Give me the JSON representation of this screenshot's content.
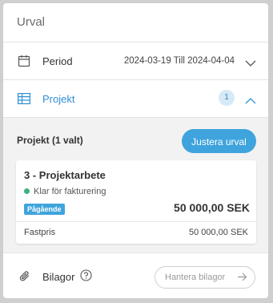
{
  "header": {
    "title": "Urval"
  },
  "period": {
    "label": "Period",
    "value": "2024-03-19 Till 2024-04-04",
    "icons": [
      "calendar-icon",
      "chevron-down-icon"
    ]
  },
  "project": {
    "label": "Projekt",
    "count": "1",
    "icons": [
      "table-icon",
      "chevron-up-icon"
    ]
  },
  "selection": {
    "title": "Projekt (1 valt)",
    "adjust_label": "Justera urval",
    "card": {
      "title": "3 - Projektarbete",
      "status": "Klar för fakturering",
      "tag": "Pågående",
      "amount": "50 000,00 SEK",
      "line_label": "Fastpris",
      "line_value": "50 000,00 SEK"
    }
  },
  "attachments": {
    "label": "Bilagor",
    "manage_label": "Hantera bilagor",
    "icons": [
      "paperclip-icon",
      "help-icon",
      "arrow-right-icon"
    ]
  },
  "colors": {
    "accent": "#3fa4dd",
    "status_green": "#3bb27e",
    "link_blue": "#2f8fd6"
  }
}
